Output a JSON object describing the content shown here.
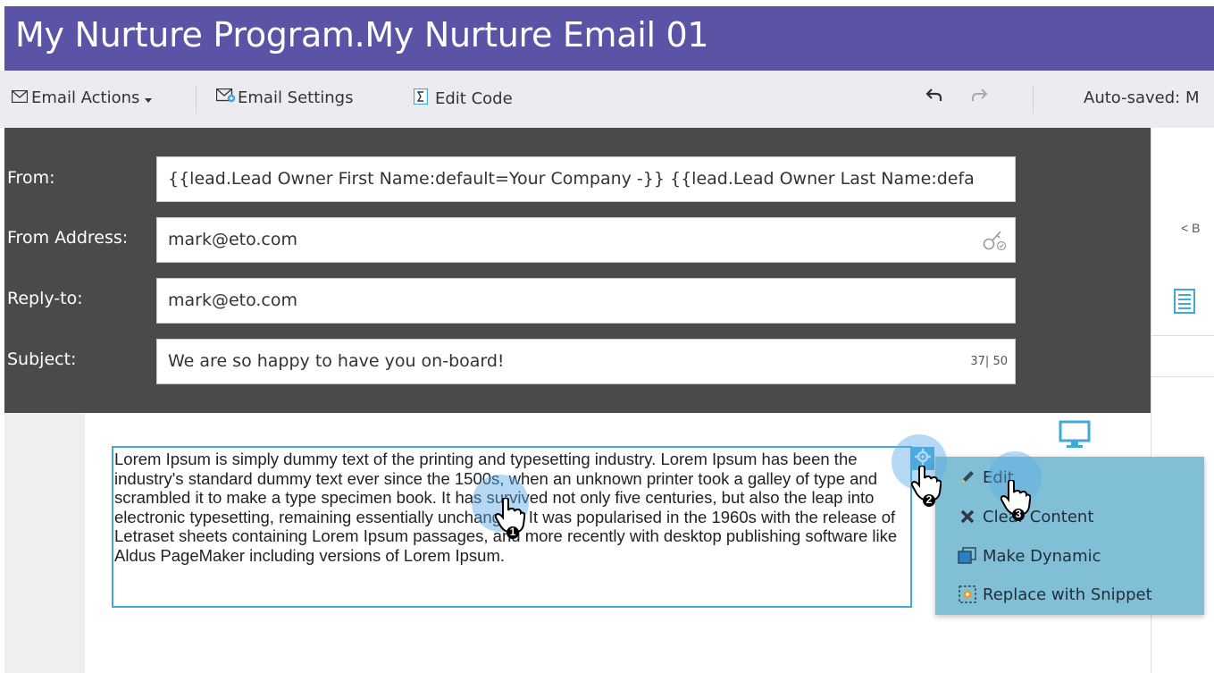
{
  "window": {
    "title": "My Nurture Program.My Nurture Email 01"
  },
  "toolbar": {
    "email_actions_label": "Email Actions",
    "email_settings_label": "Email Settings",
    "edit_code_label": "Edit Code",
    "autosave_text": "Auto-saved: M"
  },
  "header": {
    "from_label": "From:",
    "from_value": "{{lead.Lead Owner First Name:default=Your Company -}} {{lead.Lead Owner Last Name:defa",
    "from_address_label": "From Address:",
    "from_address_value": "mark@eto.com",
    "reply_to_label": "Reply-to:",
    "reply_to_value": "mark@eto.com",
    "subject_label": "Subject:",
    "subject_value": "We are so happy to have you on-board!",
    "subject_counter": "37| 50"
  },
  "right_panel": {
    "back_label": "< B"
  },
  "content": {
    "text": "Lorem Ipsum is simply dummy text of the printing and typesetting industry. Lorem Ipsum has been the industry's standard dummy text ever since the 1500s, when an unknown printer took a galley of type and scrambled it to make a type specimen book. It has survived not only five centuries, but also the leap into electronic typesetting, remaining essentially unchanged. It was popularised in the 1960s with the release of Letraset sheets containing Lorem Ipsum passages, and more recently with desktop publishing software like Aldus PageMaker including versions of Lorem Ipsum."
  },
  "context_menu": {
    "items": [
      {
        "label": "Edit",
        "icon": "pencil-icon"
      },
      {
        "label": "Clear Content",
        "icon": "x-icon"
      },
      {
        "label": "Make Dynamic",
        "icon": "dynamic-icon"
      },
      {
        "label": "Replace with Snippet",
        "icon": "snippet-icon"
      }
    ]
  },
  "callouts": {
    "step1": "1",
    "step2": "2",
    "step3": "3"
  },
  "colors": {
    "title_bar": "#5a53a6",
    "header_panel": "#4a4a4a",
    "accent": "#3fa9d9",
    "menu_bg": "#81bfd6"
  }
}
